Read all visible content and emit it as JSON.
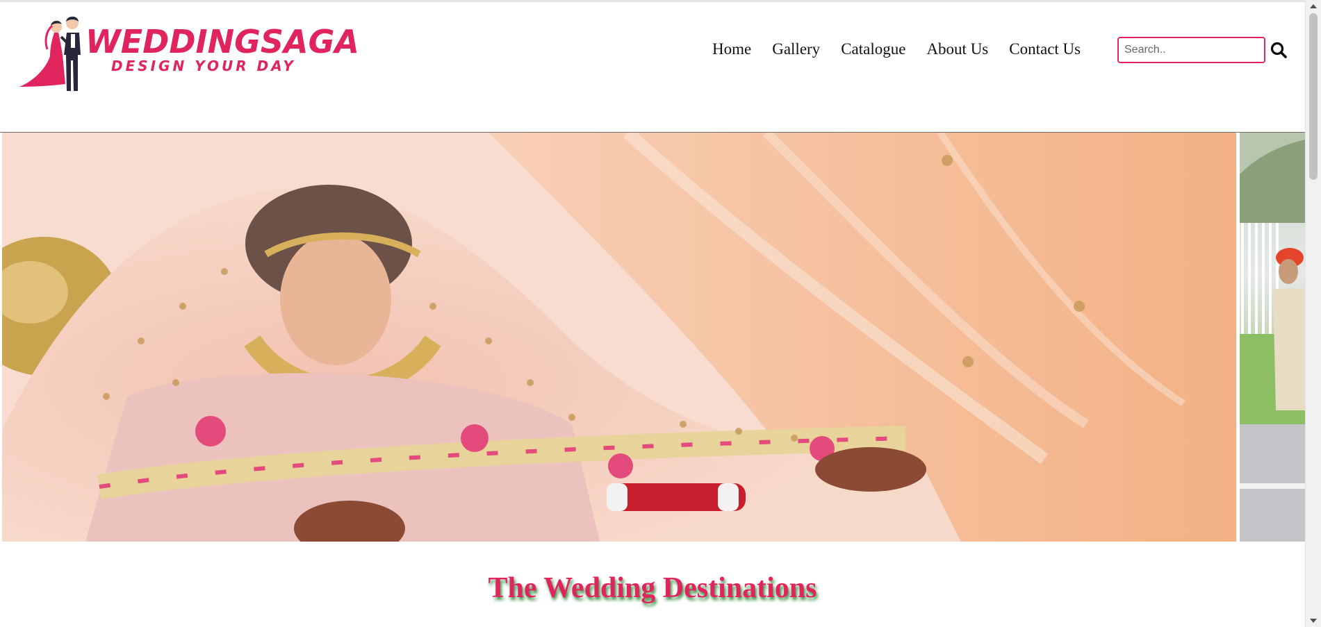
{
  "logo": {
    "title": "WEDDINGSAGA",
    "tagline": "DESIGN YOUR DAY",
    "icon": "wedding-couple-icon"
  },
  "nav": {
    "items": [
      {
        "label": "Home"
      },
      {
        "label": "Gallery"
      },
      {
        "label": "Catalogue"
      },
      {
        "label": "About Us"
      },
      {
        "label": "Contact Us"
      }
    ]
  },
  "search": {
    "placeholder": "Search..",
    "value": "",
    "icon": "search-icon"
  },
  "hero": {
    "slides": [
      "bride-with-veil-photo",
      "groom-procession-photo"
    ]
  },
  "section": {
    "title": "The Wedding Destinations"
  },
  "colors": {
    "accent": "#e0245e",
    "title_shadow": "#2e8b3a",
    "nav_text": "#111111"
  }
}
